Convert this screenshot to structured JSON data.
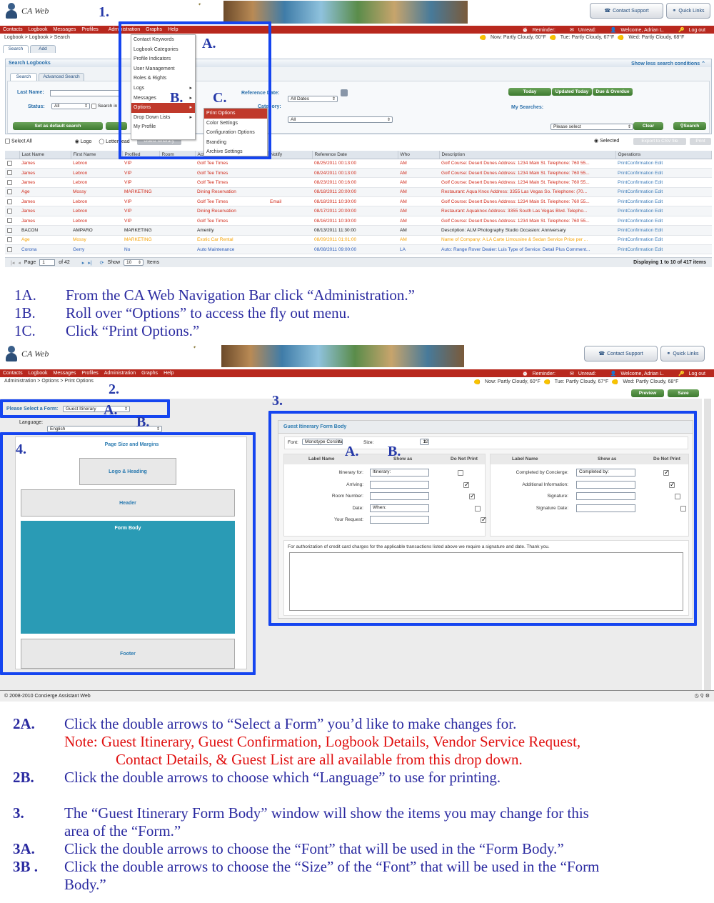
{
  "shot1": {
    "logo_text": "CA Web",
    "contact_support": "Contact Support",
    "quick_links": "Quick Links",
    "nav": [
      "Contacts",
      "Logbook",
      "Messages",
      "Profiles",
      "Administration",
      "Graphs",
      "Help"
    ],
    "reminder": "Reminder:",
    "unread": "Unread:",
    "welcome": "Welcome, Adrian L.",
    "logout": "Log out",
    "breadcrumb": "Logbook > Logbook > Search",
    "weather": [
      "Now: Partly Cloudy, 60°F",
      "Tue: Partly Cloudy, 67°F",
      "Wed: Partly Cloudy, 68°F"
    ],
    "tabs": [
      "Search",
      "Add"
    ],
    "panel_title": "Search Logbooks",
    "show_less": "Show less search conditions",
    "subtabs": [
      "Search",
      "Advanced Search"
    ],
    "last_name_label": "Last Name:",
    "status_label": "Status:",
    "status_value": "All",
    "search_in_label": "Search in",
    "ref_date_label": "Reference Date:",
    "ref_date_value": "All Dates",
    "category_label": "Category:",
    "category_value": "All",
    "quick_btns": [
      "Today",
      "Updated Today",
      "Due & Overdue"
    ],
    "my_searches_label": "My Searches:",
    "my_searches_value": "Please select",
    "set_default": "Set as default search",
    "clear": "Clear",
    "search": "Search",
    "select_all": "Select All",
    "logo_opt": "Logo",
    "letterhead_opt": "Letterhead",
    "guest_itinerary_btn": "Guest Itinerary",
    "selected_opt": "Selected",
    "export_csv": "Export to CSV file",
    "print": "Print",
    "columns": [
      "",
      "Last Name",
      "First Name",
      "Profiled",
      "Room",
      "Activity",
      "Notify",
      "Reference Date",
      "Who",
      "Description",
      "Operations"
    ],
    "rows": [
      {
        "c": "red",
        "last": "James",
        "first": "Lebron",
        "prof": "VIP",
        "act": "Golf Tee Times",
        "notify": "",
        "date": "08/25/2011 00:13:00",
        "who": "AM",
        "desc": "Golf Course: Desert Dunes Address: 1234 Main St. Telephone: 760 55...",
        "ops": "PrintConfirmation  Edit"
      },
      {
        "c": "red",
        "last": "James",
        "first": "Lebron",
        "prof": "VIP",
        "act": "Golf Tee Times",
        "notify": "",
        "date": "08/24/2011 00:13:00",
        "who": "AM",
        "desc": "Golf Course: Desert Dunes Address: 1234 Main St. Telephone: 760 55...",
        "ops": "PrintConfirmation  Edit"
      },
      {
        "c": "red",
        "last": "James",
        "first": "Lebron",
        "prof": "VIP",
        "act": "Golf Tee Times",
        "notify": "",
        "date": "08/23/2011 00:16:00",
        "who": "AM",
        "desc": "Golf Course: Desert Dunes Address: 1234 Main St. Telephone: 760 55...",
        "ops": "PrintConfirmation  Edit"
      },
      {
        "c": "red",
        "last": "Age",
        "first": "Mossy",
        "prof": "MARKETING",
        "act": "Dining Reservation",
        "notify": "",
        "date": "08/18/2011 20:00:00",
        "who": "AM",
        "desc": "Restaurant: Aqua Knox Address: 3355 Las Vegas So. Telephone: (70...",
        "ops": "PrintConfirmation  Edit"
      },
      {
        "c": "red",
        "last": "James",
        "first": "Lebron",
        "prof": "VIP",
        "act": "Golf Tee Times",
        "notify": "Email",
        "date": "08/18/2011 10:30:00",
        "who": "AM",
        "desc": "Golf Course: Desert Dunes Address: 1234 Main St. Telephone: 760 55...",
        "ops": "PrintConfirmation  Edit"
      },
      {
        "c": "red",
        "last": "James",
        "first": "Lebron",
        "prof": "VIP",
        "act": "Dining Reservation",
        "notify": "",
        "date": "08/17/2011 20:00:00",
        "who": "AM",
        "desc": "Restaurant: Aquaknox Address: 3355 South Las Vegas Blvd. Telepho...",
        "ops": "PrintConfirmation  Edit"
      },
      {
        "c": "red",
        "last": "James",
        "first": "Lebron",
        "prof": "VIP",
        "act": "Golf Tee Times",
        "notify": "",
        "date": "08/16/2011 10:30:00",
        "who": "AM",
        "desc": "Golf Course: Desert Dunes Address: 1234 Main St. Telephone: 760 55...",
        "ops": "PrintConfirmation  Edit"
      },
      {
        "c": "blk",
        "last": "BACON",
        "first": "AMPARO",
        "prof": "MARKETING",
        "act": "Amenity",
        "notify": "",
        "date": "08/13/2011 11:30:00",
        "who": "AM",
        "desc": "Description: ALM Photography Studio Occasion: Anniversary",
        "ops": "PrintConfirmation  Edit"
      },
      {
        "c": "org",
        "last": "Age",
        "first": "Mossy",
        "prof": "MARKETING",
        "act": "Exotic Car Rental",
        "notify": "",
        "date": "08/09/2011 01:01:00",
        "who": "AM",
        "desc": "Name of Company: A LA Carte Limousine & Sedan Service Price per ...",
        "ops": "PrintConfirmation  Edit"
      },
      {
        "c": "blue",
        "last": "Corona",
        "first": "Gerry",
        "prof": "No",
        "act": "Auto Maintenance",
        "notify": "",
        "date": "08/08/2011 09:00:00",
        "who": "LA",
        "desc": "Auto: Range Rover Dealer: Luis Type of Service: Detail Plus Comment...",
        "ops": "PrintConfirmation  Edit"
      }
    ],
    "pager_page": "Page",
    "pager_value": "1",
    "pager_of": "of 42",
    "pager_show": "Show",
    "pager_show_value": "10",
    "pager_items": "Items",
    "displaying": "Displaying 1 to 10 of 417 items",
    "admin_menu": [
      "Contact Keywords",
      "Logbook Categories",
      "Profile Indicators",
      "User Management",
      "Roles & Rights",
      "Logs",
      "Messages",
      "Options",
      "Drop Down Lists",
      "My Profile"
    ],
    "options_menu": [
      "Print Options",
      "Color Settings",
      "Configuration Options",
      "Branding",
      "Archive Settings"
    ]
  },
  "callouts1": {
    "n1": "1.",
    "a": "A.",
    "b": "B.",
    "c": "C."
  },
  "instr1": [
    {
      "n": "1A.",
      "t": "From the CA Web Navigation Bar click “Administration.”"
    },
    {
      "n": "1B.",
      "t": "Roll over “Options” to access the fly out menu."
    },
    {
      "n": "1C.",
      "t": "Click “Print Options.”"
    }
  ],
  "shot2": {
    "breadcrumb": "Administration > Options > Print Options",
    "preview": "Preview",
    "save": "Save",
    "select_form_label": "Please Select a Form:",
    "select_form_value": "Guest Itinerary",
    "language_label": "Language:",
    "language_value": "English",
    "page_size": "Page Size and Margins",
    "logo_heading": "Logo & Heading",
    "header": "Header",
    "form_body": "Form Body",
    "footer": "Footer",
    "form_body_title": "Guest Itinerary Form Body",
    "font_label": "Font:",
    "font_value": "Monotype Corsiva",
    "size_label": "Size:",
    "size_value": "12",
    "col_label": "Label Name",
    "col_show": "Show as",
    "col_dnp": "Do Not Print",
    "left_fields": [
      {
        "label": "Itinerary for:",
        "show": "Itinerary:",
        "dnp": false
      },
      {
        "label": "Arriving:",
        "show": "",
        "dnp": true
      },
      {
        "label": "Room Number:",
        "show": "",
        "dnp": true
      },
      {
        "label": "Date:",
        "show": "When:",
        "dnp": false
      },
      {
        "label": "Your Request:",
        "show": "",
        "dnp": true
      }
    ],
    "right_fields": [
      {
        "label": "Completed by Concierge:",
        "show": "Completed by:",
        "dnp": true
      },
      {
        "label": "Additional Information:",
        "show": "",
        "dnp": true
      },
      {
        "label": "Signature:",
        "show": "",
        "dnp": false
      },
      {
        "label": "Signature Date:",
        "show": "",
        "dnp": false
      }
    ],
    "auth_text": "For authorization of credit card charges for the applicable transactions listed above we require a signature and date. Thank you.",
    "footer_copy": "© 2008-2010 Concierge Assistant Web"
  },
  "callouts2": {
    "n2": "2.",
    "a2": "A.",
    "b2": "B.",
    "n3": "3.",
    "a3": "A.",
    "b3": "B.",
    "n4": "4."
  },
  "instr2": [
    {
      "n": "2A.",
      "t": "Click the double arrows to “Select a Form” you’d like to make changes for."
    },
    {
      "n": "",
      "t": "Note:  Guest Itinerary, Guest Confirmation, Logbook Details, Vendor Service Request,"
    },
    {
      "n": "",
      "t": "Contact Details, & Guest List are all available from this drop down."
    },
    {
      "n": "2B.",
      "t": "Click the double arrows to choose which “Language” to use for printing."
    },
    {
      "n": "3.",
      "t": "The “Guest Itinerary Form Body” window will show the items you may change for this"
    },
    {
      "n": "",
      "t": "area of the “Form.”"
    },
    {
      "n": "3A.",
      "t": "Click the double arrows to choose the “Font” that will be used in the “Form Body.”"
    },
    {
      "n": "3B .",
      "t": "Click the double arrows to choose the “Size” of the “Font” that will be used in the “Form"
    },
    {
      "n": "",
      "t": "Body.”"
    }
  ]
}
